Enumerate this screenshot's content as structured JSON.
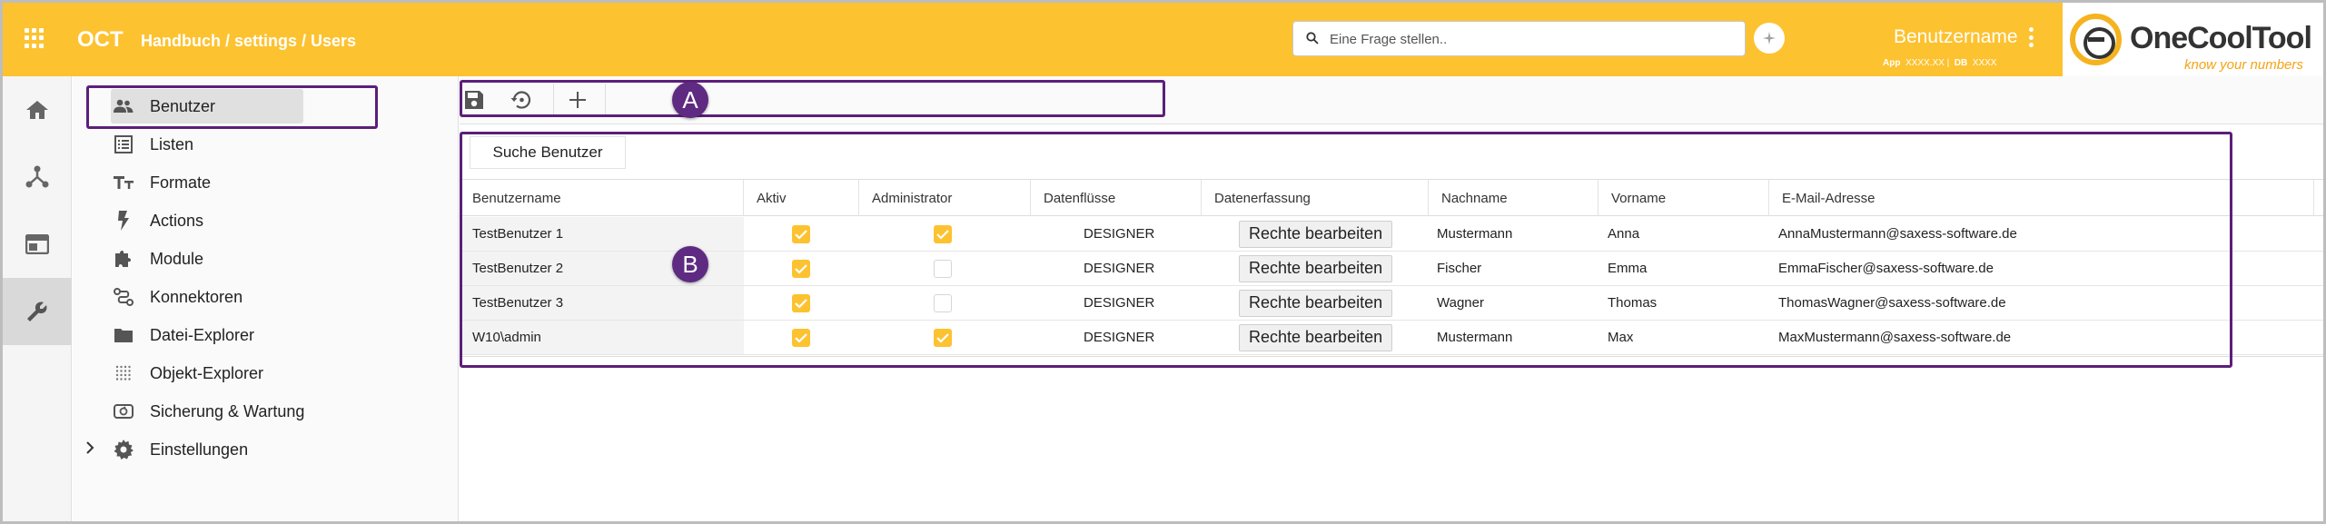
{
  "header": {
    "brand": "OCT",
    "breadcrumb": "Handbuch / settings / Users",
    "search_placeholder": "Eine Frage stellen..",
    "user_name": "Benutzername",
    "app_label": "App",
    "app_value": "XXXX.XX",
    "db_label": "DB",
    "db_value": "XXXX",
    "logo_text": "OneCoolTool",
    "logo_tagline": "know your numbers",
    "accent_color": "#fdc230"
  },
  "rail": {
    "items": [
      {
        "icon": "home-icon"
      },
      {
        "icon": "network-icon"
      },
      {
        "icon": "dashboard-icon"
      },
      {
        "icon": "wrench-icon",
        "active": true
      }
    ]
  },
  "nav": {
    "items": [
      {
        "label": "Benutzer",
        "icon": "users-icon",
        "active": true
      },
      {
        "label": "Listen",
        "icon": "list-icon"
      },
      {
        "label": "Formate",
        "icon": "format-icon"
      },
      {
        "label": "Actions",
        "icon": "bolt-icon"
      },
      {
        "label": "Module",
        "icon": "puzzle-icon"
      },
      {
        "label": "Konnektoren",
        "icon": "connector-icon"
      },
      {
        "label": "Datei-Explorer",
        "icon": "folder-icon"
      },
      {
        "label": "Objekt-Explorer",
        "icon": "object-grid-icon"
      },
      {
        "label": "Sicherung & Wartung",
        "icon": "backup-icon"
      },
      {
        "label": "Einstellungen",
        "icon": "gear-icon"
      }
    ]
  },
  "callouts": {
    "a": "A",
    "b": "B"
  },
  "main": {
    "search_tab": "Suche Benutzer",
    "columns": [
      "Benutzername",
      "Aktiv",
      "Administrator",
      "Datenflüsse",
      "Datenerfassung",
      "Nachname",
      "Vorname",
      "E-Mail-Adresse"
    ],
    "rights_button": "Rechte bearbeiten",
    "rows": [
      {
        "username": "TestBenutzer 1",
        "active": true,
        "admin": true,
        "flows": "DESIGNER",
        "last": "Mustermann",
        "first": "Anna",
        "email": "AnnaMustermann@saxess-software.de"
      },
      {
        "username": "TestBenutzer 2",
        "active": true,
        "admin": false,
        "flows": "DESIGNER",
        "last": "Fischer",
        "first": "Emma",
        "email": "EmmaFischer@saxess-software.de"
      },
      {
        "username": "TestBenutzer 3",
        "active": true,
        "admin": false,
        "flows": "DESIGNER",
        "last": "Wagner",
        "first": "Thomas",
        "email": "ThomasWagner@saxess-software.de"
      },
      {
        "username": "W10\\admin",
        "active": true,
        "admin": true,
        "flows": "DESIGNER",
        "last": "Mustermann",
        "first": "Max",
        "email": "MaxMustermann@saxess-software.de"
      }
    ]
  }
}
